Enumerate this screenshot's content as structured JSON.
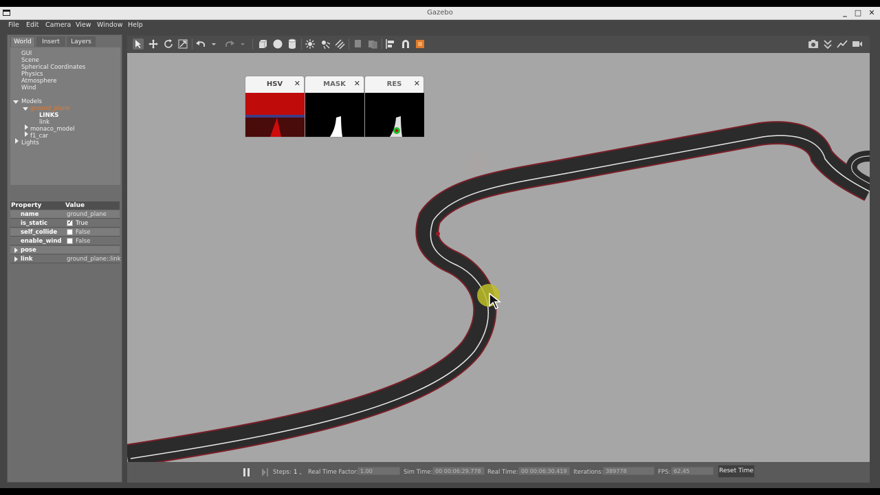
{
  "window": {
    "title": "Gazebo"
  },
  "menu": [
    "File",
    "Edit",
    "Camera",
    "View",
    "Window",
    "Help"
  ],
  "tabs": [
    "World",
    "Insert",
    "Layers"
  ],
  "tree": {
    "items": [
      "GUI",
      "Scene",
      "Spherical Coordinates",
      "Physics",
      "Atmosphere",
      "Wind",
      "Models"
    ],
    "ground_plane": "ground_plane",
    "links_label": "LINKS",
    "link": "link",
    "monaco": "monaco_model",
    "f1car": "f1_car",
    "lights": "Lights"
  },
  "properties": {
    "header_property": "Property",
    "header_value": "Value",
    "rows": [
      {
        "key": "name",
        "value": "ground_plane"
      },
      {
        "key": "is_static",
        "value": "True"
      },
      {
        "key": "self_collide",
        "value": "False"
      },
      {
        "key": "enable_wind",
        "value": "False"
      },
      {
        "key": "pose",
        "value": ""
      },
      {
        "key": "link",
        "value": "ground_plane::link"
      }
    ]
  },
  "opencv_windows": [
    "HSV",
    "MASK",
    "RES"
  ],
  "status": {
    "steps_label": "Steps:",
    "steps_value": "1",
    "rtf_label": "Real Time Factor:",
    "rtf_value": "1.00",
    "sim_label": "Sim Time:",
    "sim_value": "00 00:06:29.778",
    "real_label": "Real Time:",
    "real_value": "00 00:06:30.419",
    "iter_label": "Iterations:",
    "iter_value": "389778",
    "fps_label": "FPS:",
    "fps_value": "62.45",
    "reset_label": "Reset Time"
  },
  "colors": {
    "selected": "#e47a2e",
    "track": "#2a2a2a",
    "track_edge": "#7a1f28",
    "ground": "#a6a6a6"
  }
}
